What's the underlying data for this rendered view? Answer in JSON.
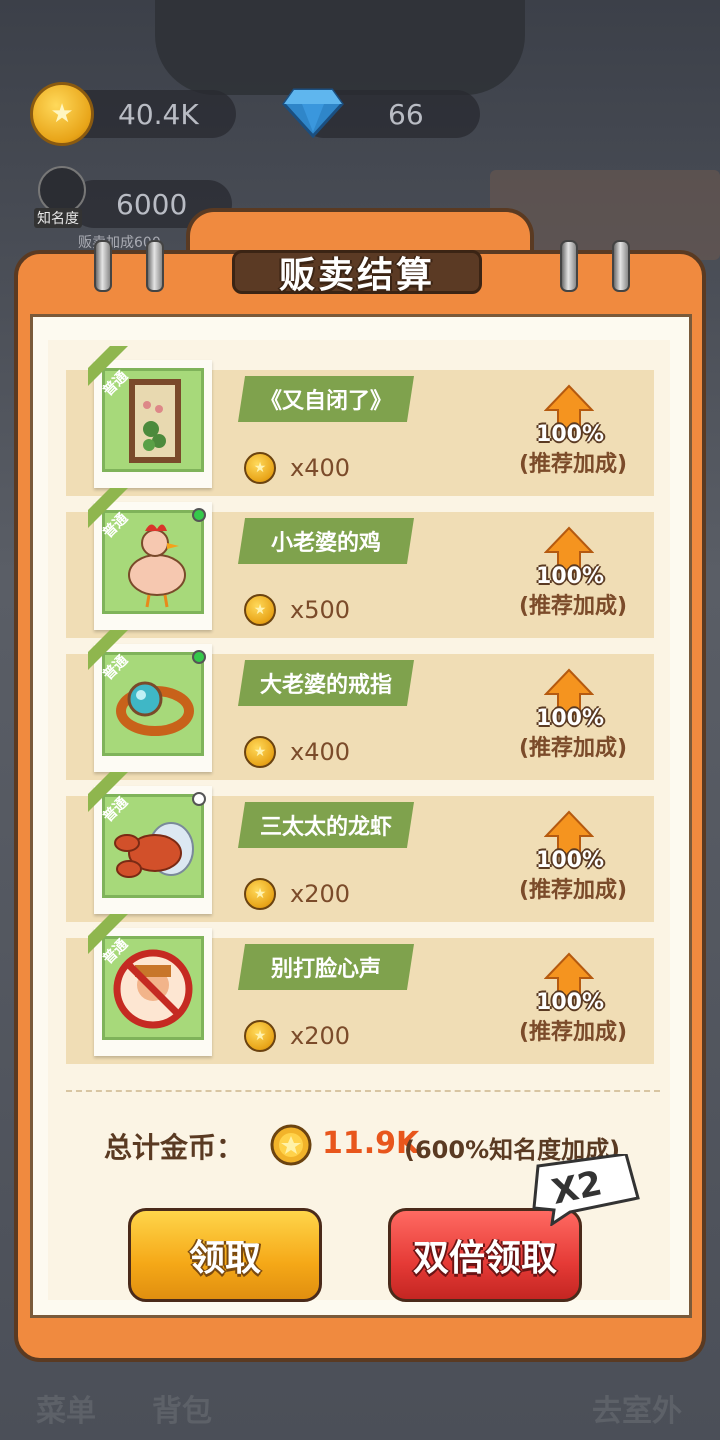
{
  "hud": {
    "coins": "40.4K",
    "gems": "66",
    "fame_value": "6000",
    "fame_label": "知名度",
    "fame_sub": "贩卖加成600"
  },
  "bottom_nav": {
    "menu": "菜单",
    "bag": "背包",
    "outdoor": "去室外"
  },
  "dialog": {
    "title": "贩卖结算",
    "items": [
      {
        "tag": "普通",
        "name": "《又自闭了》",
        "qty": "x400",
        "pct": "100%",
        "bonus": "(推荐加成)",
        "dot": ""
      },
      {
        "tag": "普通",
        "name": "小老婆的鸡",
        "qty": "x500",
        "pct": "100%",
        "bonus": "(推荐加成)",
        "dot": "#35c94a"
      },
      {
        "tag": "普通",
        "name": "大老婆的戒指",
        "qty": "x400",
        "pct": "100%",
        "bonus": "(推荐加成)",
        "dot": "#35c94a"
      },
      {
        "tag": "普通",
        "name": "三太太的龙虾",
        "qty": "x200",
        "pct": "100%",
        "bonus": "(推荐加成)",
        "dot": "#ffffff"
      },
      {
        "tag": "普通",
        "name": "别打脸心声",
        "qty": "x200",
        "pct": "100%",
        "bonus": "(推荐加成)",
        "dot": ""
      }
    ],
    "total_label": "总计金币：",
    "total_value": "11.9K",
    "total_note": "(600%知名度加成)",
    "claim_button": "领取",
    "double_button": "双倍领取",
    "x2_badge": "X2"
  },
  "colors": {
    "accent_orange": "#f08a3f",
    "claim_yellow": "#f5a817",
    "double_red": "#e53a36",
    "total_red": "#e8561c"
  }
}
